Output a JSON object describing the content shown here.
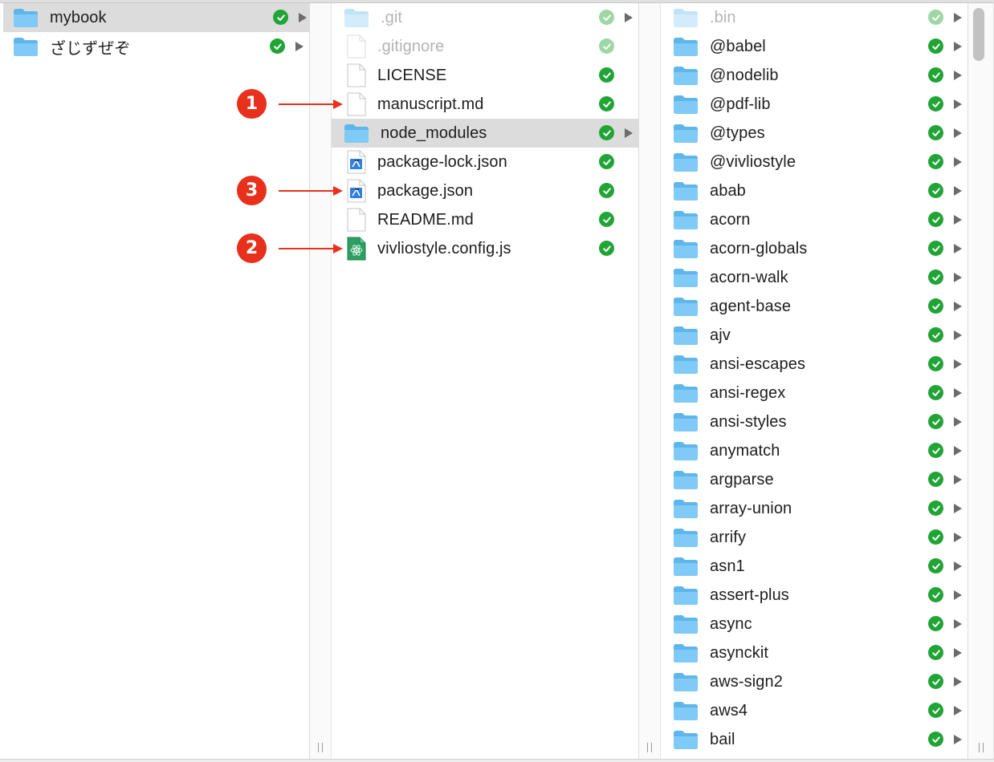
{
  "columns": {
    "col1": {
      "items": [
        {
          "name": "mybook",
          "type": "folder",
          "selected": true,
          "dim": false,
          "synced": true,
          "has_children": true
        },
        {
          "name": "ざじずぜぞ",
          "type": "folder",
          "selected": false,
          "dim": false,
          "synced": true,
          "has_children": true
        }
      ]
    },
    "col2": {
      "items": [
        {
          "name": ".git",
          "type": "folder",
          "selected": false,
          "dim": true,
          "synced": true,
          "has_children": true
        },
        {
          "name": ".gitignore",
          "type": "file",
          "selected": false,
          "dim": true,
          "synced": true,
          "has_children": false
        },
        {
          "name": "LICENSE",
          "type": "file",
          "selected": false,
          "dim": false,
          "synced": true,
          "has_children": false
        },
        {
          "name": "manuscript.md",
          "type": "file",
          "selected": false,
          "dim": false,
          "synced": true,
          "has_children": false
        },
        {
          "name": "node_modules",
          "type": "folder",
          "selected": true,
          "dim": false,
          "synced": true,
          "has_children": true
        },
        {
          "name": "package-lock.json",
          "type": "json",
          "selected": false,
          "dim": false,
          "synced": true,
          "has_children": false
        },
        {
          "name": "package.json",
          "type": "json",
          "selected": false,
          "dim": false,
          "synced": true,
          "has_children": false
        },
        {
          "name": "README.md",
          "type": "file",
          "selected": false,
          "dim": false,
          "synced": true,
          "has_children": false
        },
        {
          "name": "vivliostyle.config.js",
          "type": "js",
          "selected": false,
          "dim": false,
          "synced": true,
          "has_children": false
        }
      ]
    },
    "col3": {
      "items": [
        {
          "name": ".bin",
          "type": "folder",
          "dim": true
        },
        {
          "name": "@babel",
          "type": "folder",
          "dim": false
        },
        {
          "name": "@nodelib",
          "type": "folder",
          "dim": false
        },
        {
          "name": "@pdf-lib",
          "type": "folder",
          "dim": false
        },
        {
          "name": "@types",
          "type": "folder",
          "dim": false
        },
        {
          "name": "@vivliostyle",
          "type": "folder",
          "dim": false
        },
        {
          "name": "abab",
          "type": "folder",
          "dim": false
        },
        {
          "name": "acorn",
          "type": "folder",
          "dim": false
        },
        {
          "name": "acorn-globals",
          "type": "folder",
          "dim": false
        },
        {
          "name": "acorn-walk",
          "type": "folder",
          "dim": false
        },
        {
          "name": "agent-base",
          "type": "folder",
          "dim": false
        },
        {
          "name": "ajv",
          "type": "folder",
          "dim": false
        },
        {
          "name": "ansi-escapes",
          "type": "folder",
          "dim": false
        },
        {
          "name": "ansi-regex",
          "type": "folder",
          "dim": false
        },
        {
          "name": "ansi-styles",
          "type": "folder",
          "dim": false
        },
        {
          "name": "anymatch",
          "type": "folder",
          "dim": false
        },
        {
          "name": "argparse",
          "type": "folder",
          "dim": false
        },
        {
          "name": "array-union",
          "type": "folder",
          "dim": false
        },
        {
          "name": "arrify",
          "type": "folder",
          "dim": false
        },
        {
          "name": "asn1",
          "type": "folder",
          "dim": false
        },
        {
          "name": "assert-plus",
          "type": "folder",
          "dim": false
        },
        {
          "name": "async",
          "type": "folder",
          "dim": false
        },
        {
          "name": "asynckit",
          "type": "folder",
          "dim": false
        },
        {
          "name": "aws-sign2",
          "type": "folder",
          "dim": false
        },
        {
          "name": "aws4",
          "type": "folder",
          "dim": false
        },
        {
          "name": "bail",
          "type": "folder",
          "dim": false
        }
      ]
    }
  },
  "annotations": [
    {
      "label": "1",
      "target": "manuscript.md"
    },
    {
      "label": "3",
      "target": "package.json"
    },
    {
      "label": "2",
      "target": "vivliostyle.config.js"
    }
  ],
  "colors": {
    "selection": "#dcdcdc",
    "sync_check": "#21a436",
    "folder_blue": "#6cc3f5",
    "annotation_red": "#e8301c"
  }
}
